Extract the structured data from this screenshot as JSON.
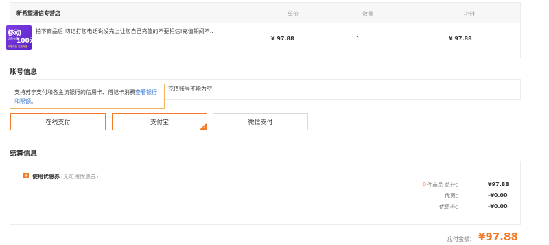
{
  "order": {
    "shop_name": "新希望通信专营店",
    "headers": {
      "price": "单价",
      "qty": "数量",
      "subtotal": "小计"
    },
    "item": {
      "image_text": {
        "top": "移动",
        "mid": "话费充值",
        "amount": "100元",
        "bottom": "每笔充值 流量充值"
      },
      "title": "拍下商品后 切记打您电话说没充上让您自己充值的不要相信!充值期间不...",
      "price": "¥ 97.88",
      "qty": "1",
      "subtotal": "¥ 97.88"
    }
  },
  "account": {
    "section_title": "账号信息",
    "message": "充值账号不能为空"
  },
  "tooltip": {
    "text": "支持苏宁支付和各主流银行的信用卡、借记卡消费",
    "link": "查看银行和限额",
    "tail": "。"
  },
  "payment": {
    "online": "在线支付",
    "alipay": "支付宝",
    "wechat": "微信支付",
    "check": "✓"
  },
  "settlement": {
    "section_title": "结算信息",
    "coupon_icon": "+",
    "coupon_label": "使用优惠券",
    "coupon_note": "(无可用优惠券)",
    "count": "0",
    "count_label": "件商品",
    "total_label": "总计：",
    "total_value": "¥97.88",
    "discount_label": "优惠：",
    "discount_value": "-¥0.00",
    "coupon_sum_label": "优惠券：",
    "coupon_sum_value": "-¥0.00",
    "payable_label": "应付金额：",
    "payable_value": "¥97.88"
  },
  "colors": {
    "accent": "#f17b2a",
    "link": "#3a78d4",
    "tooltip_border": "#f0b65f",
    "product_bg": "#7d3ce2"
  }
}
